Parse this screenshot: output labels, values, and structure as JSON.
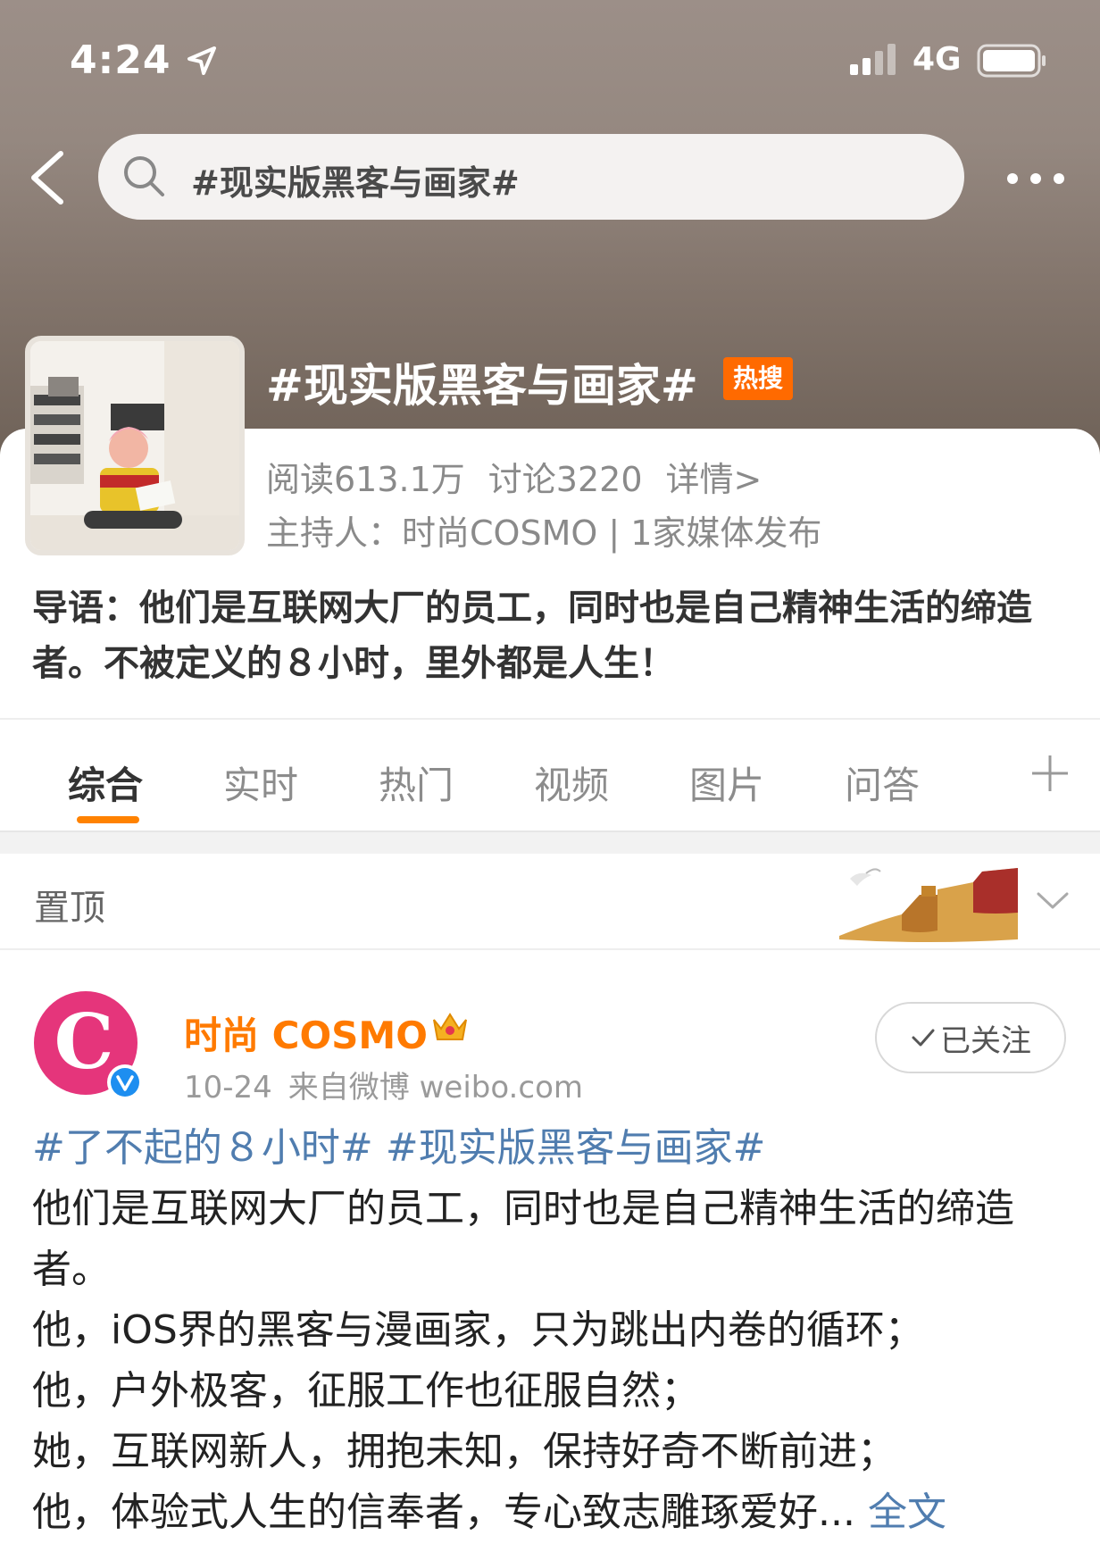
{
  "status_bar": {
    "time": "4:24",
    "network": "4G"
  },
  "search": {
    "query": "#现实版黑客与画家#"
  },
  "topic": {
    "title": "#现实版黑客与画家#",
    "badge": "热搜",
    "reads": "阅读613.1万",
    "discussions": "讨论3220",
    "details": "详情>",
    "host": "主持人：时尚COSMO | 1家媒体发布",
    "intro": "导语：他们是互联网大厂的员工，同时也是自己精神生活的缔造者。不被定义的８小时，里外都是人生！"
  },
  "tabs": [
    {
      "label": "综合",
      "active": true
    },
    {
      "label": "实时"
    },
    {
      "label": "热门"
    },
    {
      "label": "视频"
    },
    {
      "label": "图片"
    },
    {
      "label": "问答"
    }
  ],
  "pinned": {
    "label": "置顶"
  },
  "post": {
    "author": "时尚 COSMO",
    "date": "10-24",
    "source": "来自微博 weibo.com",
    "follow_label": "已关注",
    "tags": "#了不起的８小时# #现实版黑客与画家#",
    "lines": [
      "他们是互联网大厂的员工，同时也是自己精神生活的缔造者。",
      "他，iOS界的黑客与漫画家，只为跳出内卷的循环；",
      "他，户外极客，征服工作也征服自然；",
      "她，互联网新人，拥抱未知，保持好奇不断前进；"
    ],
    "last_line": "他，体验式人生的信奉者，专心致志雕琢爱好...",
    "full_text": "全文"
  },
  "colors": {
    "accent": "#ff8200",
    "link": "#507daf",
    "badge": "#ff6a00"
  }
}
